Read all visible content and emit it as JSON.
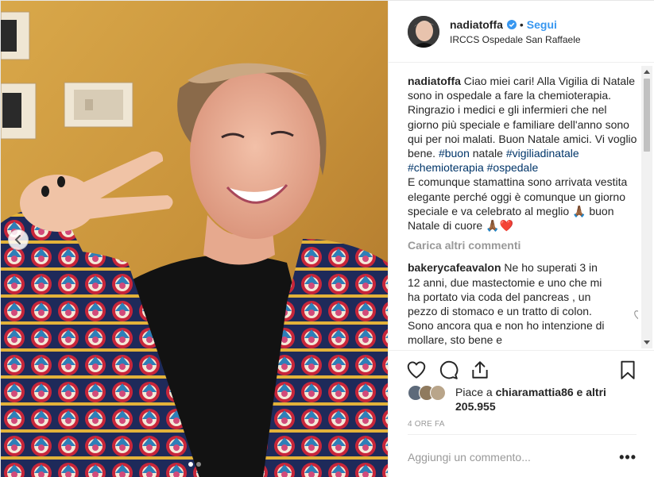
{
  "post": {
    "username": "nadiatoffa",
    "separator": "•",
    "follow_label": "Segui",
    "location": "IRCCS Ospedale San Raffaele"
  },
  "caption": {
    "username": "nadiatoffa",
    "text_1": "Ciao miei cari! Alla Vigilia di Natale sono in ospedale a fare la chemioterapia. Ringrazio i medici e gli infermieri che nel giorno più speciale e familiare dell'anno sono qui per noi malati. Buon Natale amici. Vi voglio bene.",
    "tag_1": "#buon",
    "text_2": "natale",
    "tag_2": "#vigiliadinatale",
    "tag_3": "#chemioterapia",
    "tag_4": "#ospedale",
    "text_3": "E comunque stamattina sono arrivata vestita elegante perché oggi è comunque un giorno speciale e va celebrato al meglio",
    "emoji_hands_1": "🙏🏾",
    "text_4": "buon Natale di cuore",
    "emoji_hands_2": "🙏🏾",
    "emoji_heart": "❤️"
  },
  "load_more_label": "Carica altri commenti",
  "comment": {
    "username": "bakerycafeavalon",
    "text": "Ne ho superati 3 in 12 anni, due mastectomie e uno che mi ha portato via coda del pancreas , un pezzo di stomaco e un tratto di colon. Sono ancora qua e non ho intenzione di mollare, sto bene e"
  },
  "likes": {
    "prefix": "Piace a",
    "user": "chiaramattia86",
    "conj": "e",
    "others": "altri 205.955"
  },
  "timestamp": "4 ore fa",
  "add_comment_placeholder": "Aggiungi un commento...",
  "more_label": "•••",
  "icons": {
    "verified": "verified-badge-icon",
    "heart": "heart-icon",
    "comment": "comment-icon",
    "share": "share-icon",
    "bookmark": "bookmark-icon",
    "carousel_prev": "chevron-left-icon"
  },
  "colors": {
    "link_blue": "#3897f0",
    "hashtag": "#003569",
    "muted": "#999999",
    "heart_red": "#ed4956"
  },
  "carousel": {
    "slides": 2,
    "active": 1
  }
}
